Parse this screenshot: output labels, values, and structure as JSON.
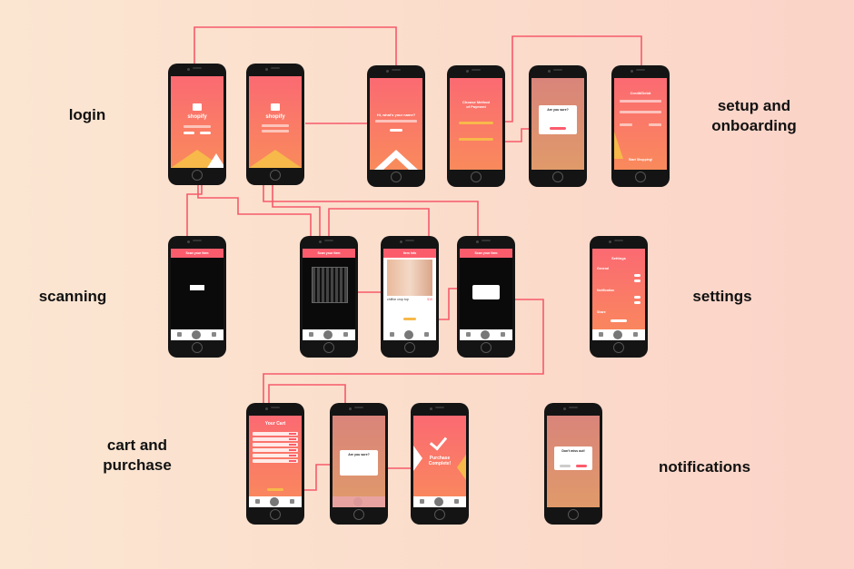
{
  "colors": {
    "accent": "#fb5c6c",
    "orange": "#f98a5c",
    "line": "#f65a6a",
    "phone": "#141414"
  },
  "rows": {
    "login": "login",
    "setup_line1": "setup and",
    "setup_line2": "onboarding",
    "scanning": "scanning",
    "settings": "settings",
    "cart_line1": "cart and",
    "cart_line2": "purchase",
    "notifications": "notifications"
  },
  "screens": {
    "login1": {
      "brand": "shopify"
    },
    "login2": {
      "brand": "shopify"
    },
    "name": {
      "question": "Hi, what's your name?"
    },
    "payment": {
      "title_line1": "Choose Method",
      "title_line2": "of Payment"
    },
    "confirm1": {
      "title": "Are you sure?"
    },
    "card": {
      "title": "Credit/Debit",
      "cta": "Start Shopping!"
    },
    "scan1": {
      "header": "Scan your Item"
    },
    "scan2": {
      "header": "Scan your Item"
    },
    "item": {
      "header": "Item Info",
      "product": "chiffon crop top",
      "price": "$15"
    },
    "scan3": {
      "header": "Scan your Item"
    },
    "settings": {
      "title": "Settings",
      "section1": "General",
      "section2": "Notification",
      "section3": "Share"
    },
    "cart": {
      "title": "Your Cart"
    },
    "confirm2": {
      "title": "Are you sure?"
    },
    "complete": {
      "line1": "Purchase",
      "line2": "Complete!"
    },
    "notif": {
      "title": "Don't miss out!"
    }
  }
}
